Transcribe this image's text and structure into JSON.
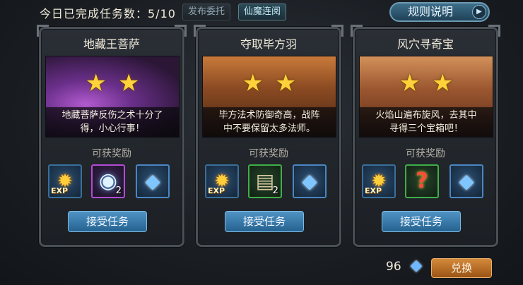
{
  "header": {
    "progress_text": "今日已完成任务数：5/10",
    "tab_publish": "发布委托",
    "tab_xianmo": "仙魔连阅",
    "rules_label": "规则说明",
    "rules_arrow": "▶"
  },
  "reward_label": "可获奖励",
  "accept_label": "接受任务",
  "cards": [
    {
      "title": "地藏王菩萨",
      "stars": 2,
      "desc_line1": "地藏菩萨反伤之术十分了",
      "desc_line2": "得，小心行事！",
      "rewards": [
        {
          "icon": "exp-icon",
          "label": "EXP"
        },
        {
          "icon": "spirit-orb-icon",
          "count": "2"
        },
        {
          "icon": "blue-gem-icon"
        }
      ]
    },
    {
      "title": "夺取毕方羽",
      "stars": 2,
      "desc_line1": "毕方法术防御奇高，战阵",
      "desc_line2": "中不要保留太多法师。",
      "rewards": [
        {
          "icon": "exp-icon",
          "label": "EXP"
        },
        {
          "icon": "scroll-icon",
          "count": "2"
        },
        {
          "icon": "blue-gem-icon"
        }
      ]
    },
    {
      "title": "风穴寻奇宝",
      "stars": 2,
      "desc_line1": "火焰山遍布旋风，去其中",
      "desc_line2": "寻得三个宝箱吧！",
      "rewards": [
        {
          "icon": "exp-icon",
          "label": "EXP"
        },
        {
          "icon": "mystery-icon"
        },
        {
          "icon": "blue-gem-icon"
        }
      ]
    }
  ],
  "footer": {
    "currency_amount": "96",
    "exchange_label": "兑换"
  },
  "glyphs": {
    "star": "★",
    "exp": "✹",
    "orb": "◉",
    "gem": "◆",
    "scroll": "▤",
    "mystery": "?"
  },
  "colors": {
    "star": "#ffd23a",
    "accept_button": "#256290",
    "exchange_button": "#9b5416"
  }
}
